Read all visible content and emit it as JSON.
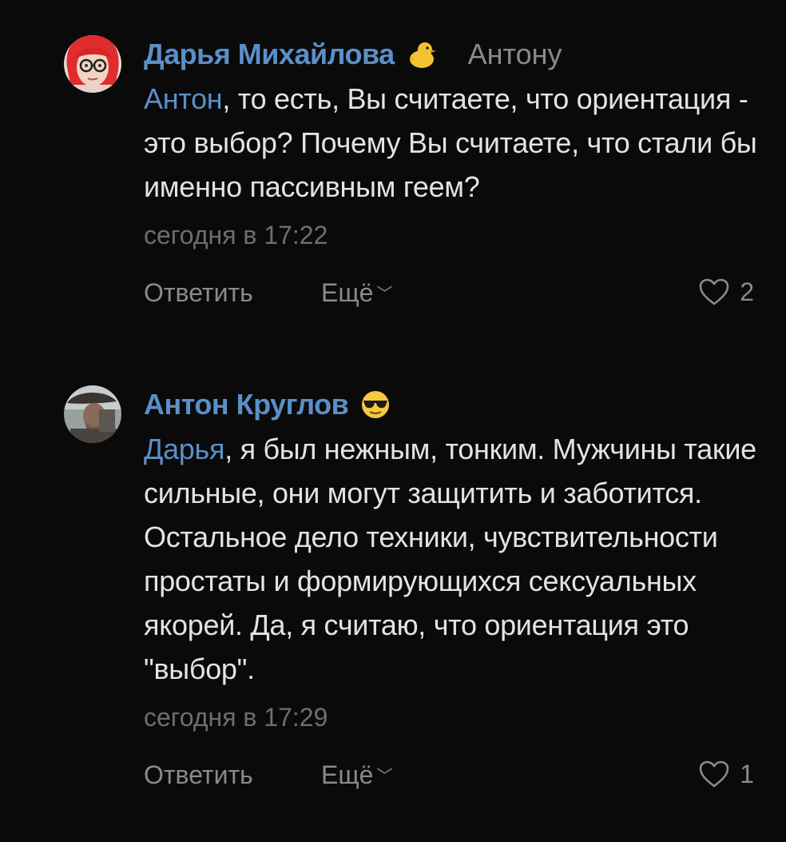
{
  "comments": [
    {
      "author": "Дарья Михайлова",
      "author_emoji_icon": "chick-emoji",
      "reply_to": "Антону",
      "mention": "Антон",
      "text": ", то есть, Вы считаете, что ориентация - это выбор? Почему Вы считаете, что стали бы именно пассивным геем?",
      "time": "сегодня в 17:22",
      "reply_label": "Ответить",
      "more_label": "Ещё",
      "likes": "2"
    },
    {
      "author": "Антон Круглов",
      "author_emoji_icon": "sunglasses-emoji",
      "mention": "Дарья",
      "text": ", я был нежным, тонким. Мужчины такие сильные, они могут защитить и заботится. Остальное дело техники, чувствительности простаты и формирующихся сексуальных якорей. Да, я считаю, что ориентация это \"выбор\".",
      "time": "сегодня в 17:29",
      "reply_label": "Ответить",
      "more_label": "Ещё",
      "likes": "1"
    }
  ],
  "colors": {
    "background": "#0a0a0a",
    "link": "#5b8fc7",
    "text": "#e3e3e3",
    "muted": "#8a8a8a"
  }
}
